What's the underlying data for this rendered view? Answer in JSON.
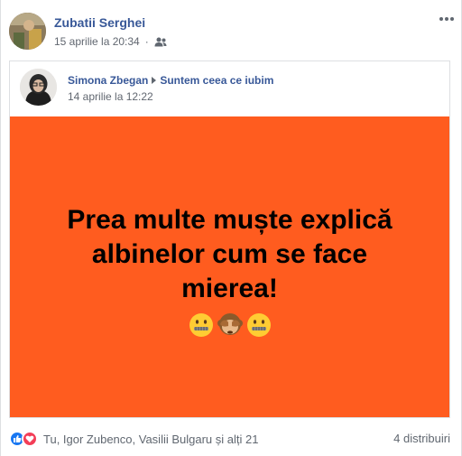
{
  "post": {
    "author": "Zubatii Serghei",
    "timestamp": "15 aprilie la 20:34",
    "audience_icon": "friends-icon",
    "more_icon": "more-options-icon"
  },
  "shared": {
    "author": "Simona Zbegan",
    "group": "Suntem ceea ce iubim",
    "timestamp": "14 aprilie la 12:22",
    "image": {
      "line1": "Prea multe muște explică",
      "line2": "albinelor cum se face",
      "line3": "mierea!",
      "background_color": "#ff5c1f",
      "emojis": [
        "zipper-mouth-emoji",
        "see-no-evil-monkey-emoji",
        "zipper-mouth-emoji"
      ]
    }
  },
  "footer": {
    "reactions_text": "Tu, Igor Zubenco, Vasilii Bulgaru și alți 21",
    "shares_text": "4 distribuiri",
    "reaction_icons": [
      "like-icon",
      "love-icon"
    ]
  }
}
